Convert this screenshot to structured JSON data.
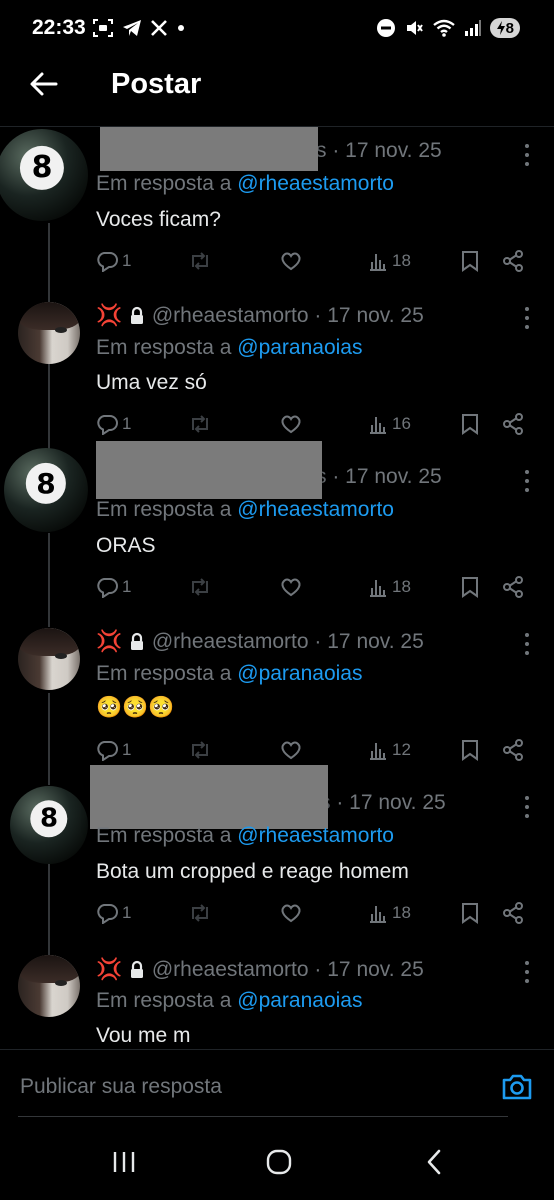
{
  "status_bar": {
    "time": "22:33",
    "left_icons": [
      "screenshot-icon",
      "telegram-icon",
      "x-logo-icon",
      "dot-icon"
    ],
    "right_icons": [
      "do-not-disturb-icon",
      "mute-icon",
      "wifi-icon",
      "signal-icon"
    ],
    "battery": "8"
  },
  "header": {
    "title": "Postar"
  },
  "posts": [
    {
      "handle_suffix": "s",
      "date": "· 17 nov. 25",
      "reply_prefix": "Em resposta a",
      "reply_handle": "@rheaestamorto",
      "text": "Voces ficam?",
      "replies": "1",
      "views": "18"
    },
    {
      "badge": "💢",
      "handle": "@rheaestamorto",
      "date": "· 17 nov. 25",
      "reply_prefix": "Em resposta a",
      "reply_handle": "@paranaoias",
      "text": "Uma vez só",
      "replies": "1",
      "views": "16"
    },
    {
      "handle_suffix": "s",
      "date": "· 17 nov. 25",
      "reply_prefix": "Em resposta a",
      "reply_handle": "@rheaestamorto",
      "text": "ORAS",
      "replies": "1",
      "views": "18"
    },
    {
      "badge": "💢",
      "handle": "@rheaestamorto",
      "date": "· 17 nov. 25",
      "reply_prefix": "Em resposta a",
      "reply_handle": "@paranaoias",
      "text": "🥺🥺🥺",
      "replies": "1",
      "views": "12"
    },
    {
      "handle_suffix": "s",
      "date": "· 17 nov. 25",
      "reply_prefix": "Em resposta a",
      "reply_handle": "@rheaestamorto",
      "text": "Bota um cropped e reage homem",
      "replies": "1",
      "views": "18"
    },
    {
      "badge": "💢",
      "handle": "@rheaestamorto",
      "date": "· 17 nov. 25",
      "reply_prefix": "Em resposta a",
      "reply_handle": "@paranaoias",
      "text": "Vou me m"
    }
  ],
  "composer": {
    "placeholder": "Publicar sua resposta"
  },
  "colors": {
    "background": "#000000",
    "text": "#e7e9ea",
    "muted": "#71767b",
    "link": "#1d9bf0",
    "divider": "#1f2327"
  }
}
